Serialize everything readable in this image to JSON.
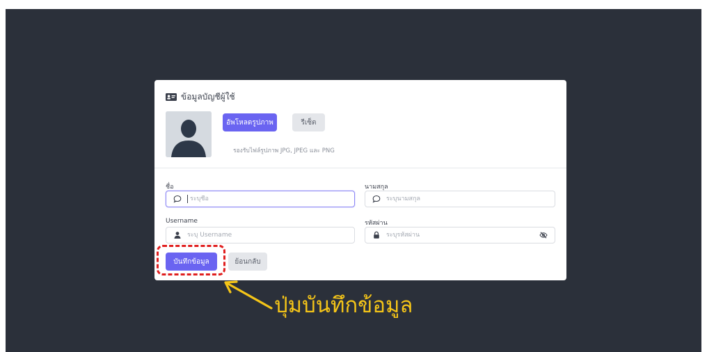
{
  "card": {
    "title": "ข้อมูลบัญชีผู้ใช้",
    "upload_label": "อัพโหลดรูปภาพ",
    "reset_label": "รีเซ็ต",
    "hint": "รองรับไฟล์รูปภาพ JPG, JPEG และ PNG"
  },
  "form": {
    "first_name": {
      "label": "ชื่อ",
      "placeholder": "ระบุชื่อ",
      "value": ""
    },
    "last_name": {
      "label": "นามสกุล",
      "placeholder": "ระบุนามสกุล",
      "value": ""
    },
    "username": {
      "label": "Username",
      "placeholder": "ระบุ Username",
      "value": ""
    },
    "password": {
      "label": "รหัสผ่าน",
      "placeholder": "ระบุรหัสผ่าน",
      "value": ""
    }
  },
  "actions": {
    "save_label": "บันทึกข้อมูล",
    "back_label": "ย้อนกลับ"
  },
  "annotation": {
    "text": "ปุ่มบันทึกข้อมูล",
    "color": "#f5c518",
    "highlight_color": "#e01e1e"
  },
  "colors": {
    "background": "#2b303a",
    "accent": "#6a64f1"
  },
  "icons": {
    "title": "id-card-icon",
    "first_name": "chat-bubble-icon",
    "last_name": "chat-bubble-icon",
    "username": "user-icon",
    "password": "lock-icon",
    "password_toggle": "eye-slash-icon"
  }
}
